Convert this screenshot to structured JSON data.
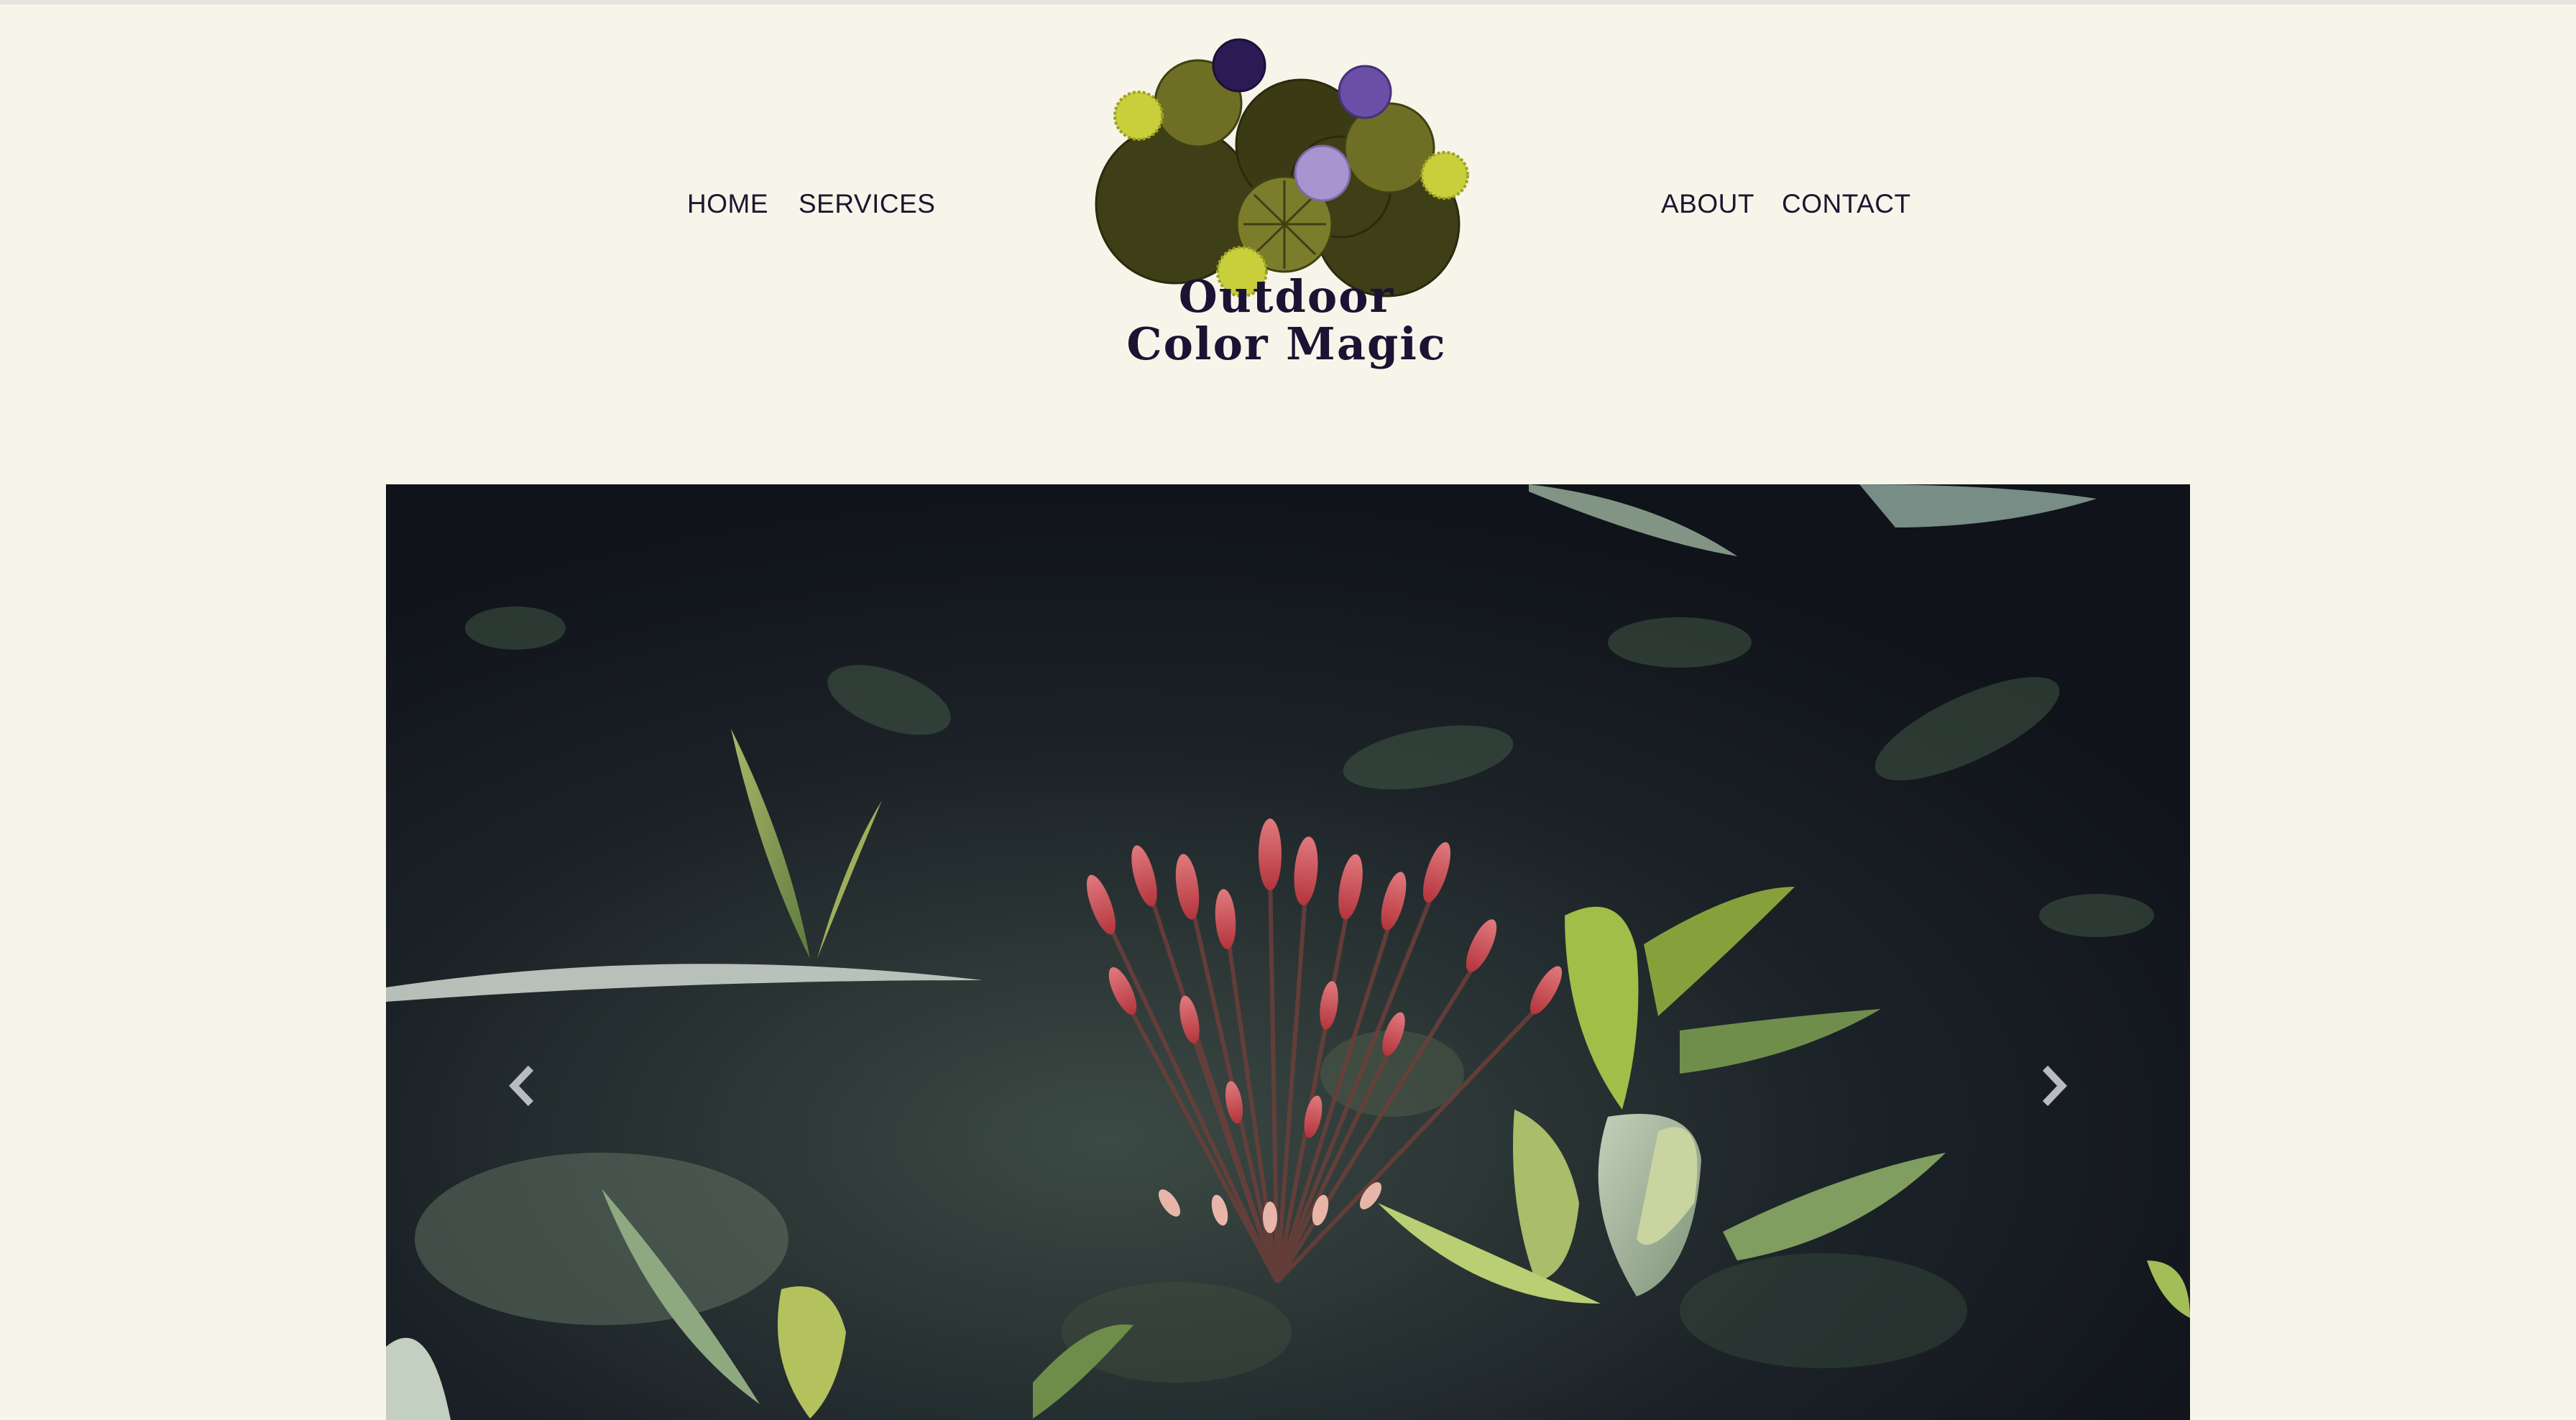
{
  "nav": {
    "left": [
      {
        "label": "HOME"
      },
      {
        "label": "SERVICES"
      }
    ],
    "right": [
      {
        "label": "ABOUT"
      },
      {
        "label": "CONTACT"
      }
    ]
  },
  "logo": {
    "line1": "Outdoor",
    "line2": "Color Magic"
  },
  "carousel": {
    "prev_icon": "chevron-left-icon",
    "next_icon": "chevron-right-icon"
  },
  "colors": {
    "background": "#f7f5e9",
    "nav_text": "#1b1630",
    "logo_text": "#1c1233",
    "logo_dark_green": "#3e3f16",
    "logo_olive": "#6e6f25",
    "logo_yellow": "#c9cf3a",
    "logo_purple_dark": "#2b1b55",
    "logo_purple": "#6b4ea5",
    "logo_lavender": "#a895cf"
  }
}
